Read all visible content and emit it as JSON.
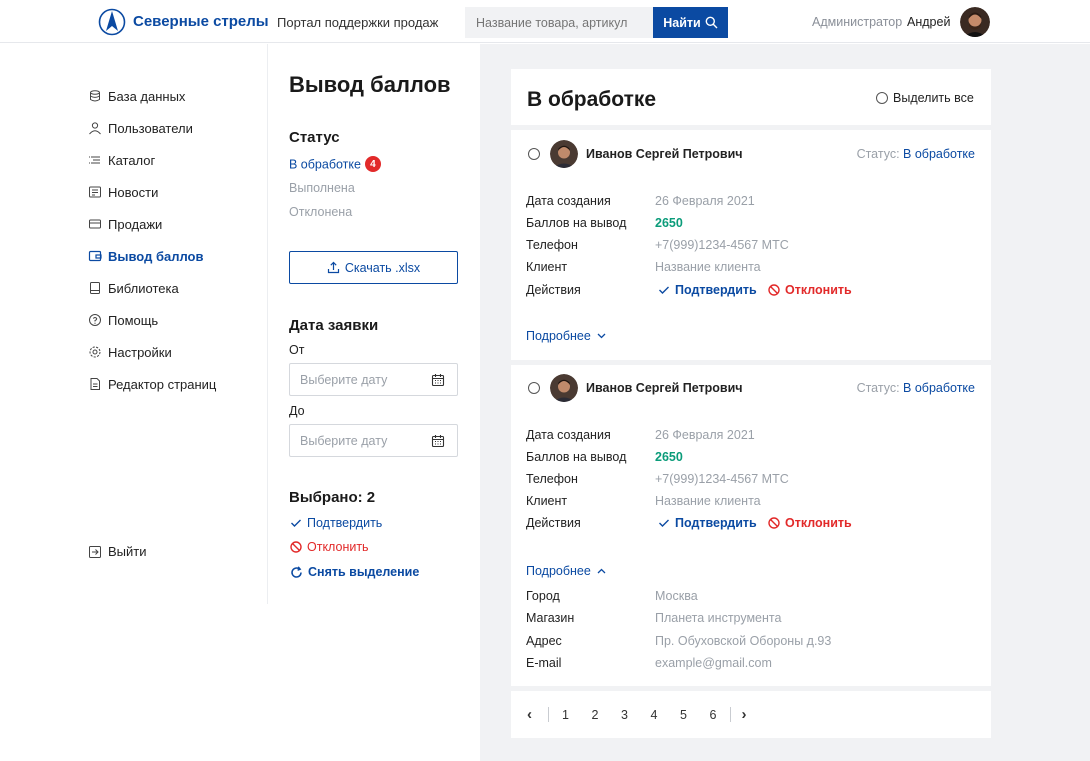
{
  "header": {
    "brand": "Северные стрелы",
    "portal": "Портал поддержки продаж",
    "search_placeholder": "Название товара, артикул",
    "search_button": "Найти",
    "role": "Администратор",
    "user": "Андрей"
  },
  "sidebar": {
    "items": [
      {
        "label": "База данных",
        "icon": "database-icon"
      },
      {
        "label": "Пользователи",
        "icon": "users-icon"
      },
      {
        "label": "Каталог",
        "icon": "catalog-icon"
      },
      {
        "label": "Новости",
        "icon": "news-icon"
      },
      {
        "label": "Продажи",
        "icon": "sales-icon"
      },
      {
        "label": "Вывод баллов",
        "icon": "withdraw-icon",
        "active": true
      },
      {
        "label": "Библиотека",
        "icon": "library-icon"
      },
      {
        "label": "Помощь",
        "icon": "help-icon"
      },
      {
        "label": "Настройки",
        "icon": "settings-icon"
      },
      {
        "label": "Редактор страниц",
        "icon": "page-editor-icon"
      }
    ],
    "logout": "Выйти"
  },
  "filters": {
    "page_title": "Вывод баллов",
    "status_title": "Статус",
    "statuses": [
      {
        "label": "В обработке",
        "count": "4",
        "active": true
      },
      {
        "label": "Выполнена"
      },
      {
        "label": "Отклонена"
      }
    ],
    "download": "Скачать .xlsx",
    "date_title": "Дата заявки",
    "from_label": "От",
    "to_label": "До",
    "date_placeholder": "Выберите дату",
    "selected": "Выбрано: 2",
    "confirm": "Подтвердить",
    "reject": "Отклонить",
    "clear": "Снять выделение"
  },
  "list": {
    "title": "В обработке",
    "select_all": "Выделить все",
    "records": [
      {
        "name": "Иванов Сергей Петрович",
        "status_prefix": "Статус:",
        "status": "В обработке",
        "labels": [
          "Дата создания",
          "Баллов на вывод",
          "Телефон",
          "Клиент",
          "Действия"
        ],
        "date": "26 Февраля 2021",
        "points": "2650",
        "phone": "+7(999)1234-4567 МТС",
        "client": "Название клиента",
        "confirm": "Подтвердить",
        "reject": "Отклонить",
        "more": "Подробнее"
      },
      {
        "name": "Иванов Сергей Петрович",
        "status_prefix": "Статус:",
        "status": "В обработке",
        "labels": [
          "Дата создания",
          "Баллов на вывод",
          "Телефон",
          "Клиент",
          "Действия"
        ],
        "date": "26 Февраля 2021",
        "points": "2650",
        "phone": "+7(999)1234-4567 МТС",
        "client": "Название клиента",
        "confirm": "Подтвердить",
        "reject": "Отклонить",
        "more": "Подробнее",
        "details_labels": [
          "Город",
          "Магазин",
          "Адрес",
          "E-mail"
        ],
        "details_values": [
          "Москва",
          "Планета инструмента",
          "Пр. Обуховской Обороны д.93",
          "example@gmail.com"
        ]
      }
    ]
  },
  "pagination": {
    "pages": [
      "1",
      "2",
      "3",
      "4",
      "5",
      "6"
    ],
    "prev": "‹",
    "next": "›"
  },
  "colors": {
    "primary": "#0b4aa2",
    "danger": "#e22a2a",
    "points": "#0b9c7a",
    "panel_bg": "#f1f2f4"
  }
}
